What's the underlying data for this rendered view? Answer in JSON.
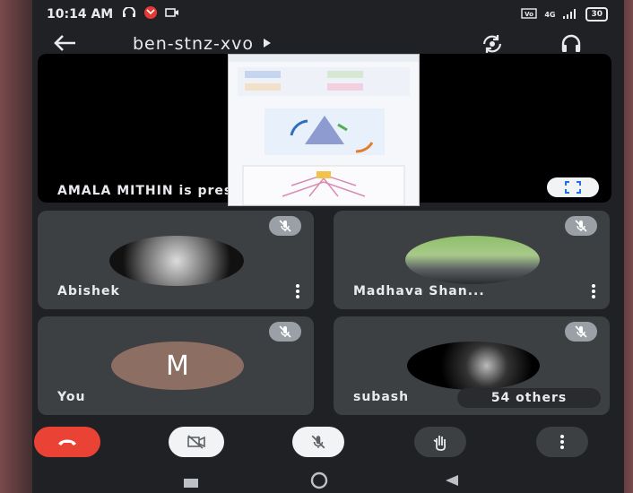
{
  "status_bar": {
    "time": "10:14 AM",
    "network": "4G",
    "battery": "30"
  },
  "meeting": {
    "code": "ben-stnz-xvo"
  },
  "presentation": {
    "label": "AMALA MITHIN is presenting"
  },
  "participants": [
    {
      "name": "Abishek",
      "muted": true
    },
    {
      "name": "Madhava Shan...",
      "muted": true
    },
    {
      "name": "You",
      "initial": "M",
      "avatar_color": "#8d6e63",
      "muted": true
    },
    {
      "name": "subash",
      "muted": true
    }
  ],
  "others_badge": "54 others",
  "controls": {
    "end_call_color": "#ea4335"
  }
}
